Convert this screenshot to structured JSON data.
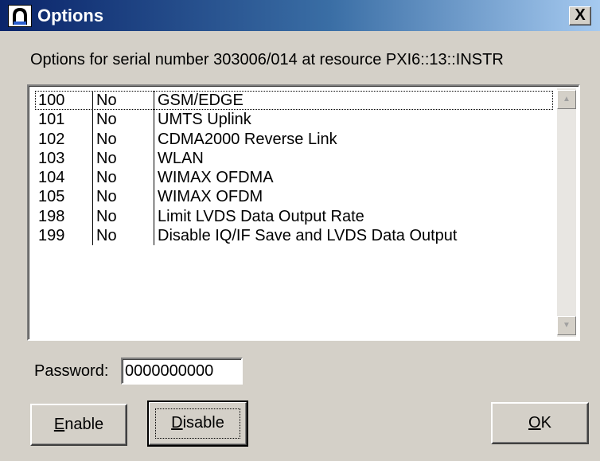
{
  "window": {
    "title": "Options",
    "close_label": "X",
    "app_icon": "arch-icon"
  },
  "caption": "Options for serial number 303006/014 at resource PXI6::13::INSTR",
  "options": [
    {
      "number": "100",
      "enabled": "No",
      "name": "GSM/EDGE"
    },
    {
      "number": "101",
      "enabled": "No",
      "name": "UMTS Uplink"
    },
    {
      "number": "102",
      "enabled": "No",
      "name": "CDMA2000 Reverse Link"
    },
    {
      "number": "103",
      "enabled": "No",
      "name": "WLAN"
    },
    {
      "number": "104",
      "enabled": "No",
      "name": "WIMAX OFDMA"
    },
    {
      "number": "105",
      "enabled": "No",
      "name": "WIMAX OFDM"
    },
    {
      "number": "198",
      "enabled": "No",
      "name": "Limit LVDS Data Output Rate"
    },
    {
      "number": "199",
      "enabled": "No",
      "name": "Disable IQ/IF Save and LVDS Data Output"
    }
  ],
  "scrollbar": {
    "up_icon": "scroll-up-arrow-icon",
    "down_icon": "scroll-down-arrow-icon"
  },
  "password": {
    "label": "Password:",
    "value": "0000000000"
  },
  "buttons": {
    "enable": {
      "mnemonic": "E",
      "rest": "nable"
    },
    "disable": {
      "mnemonic": "D",
      "rest": "isable"
    },
    "ok": {
      "mnemonic": "O",
      "rest": "K"
    }
  }
}
